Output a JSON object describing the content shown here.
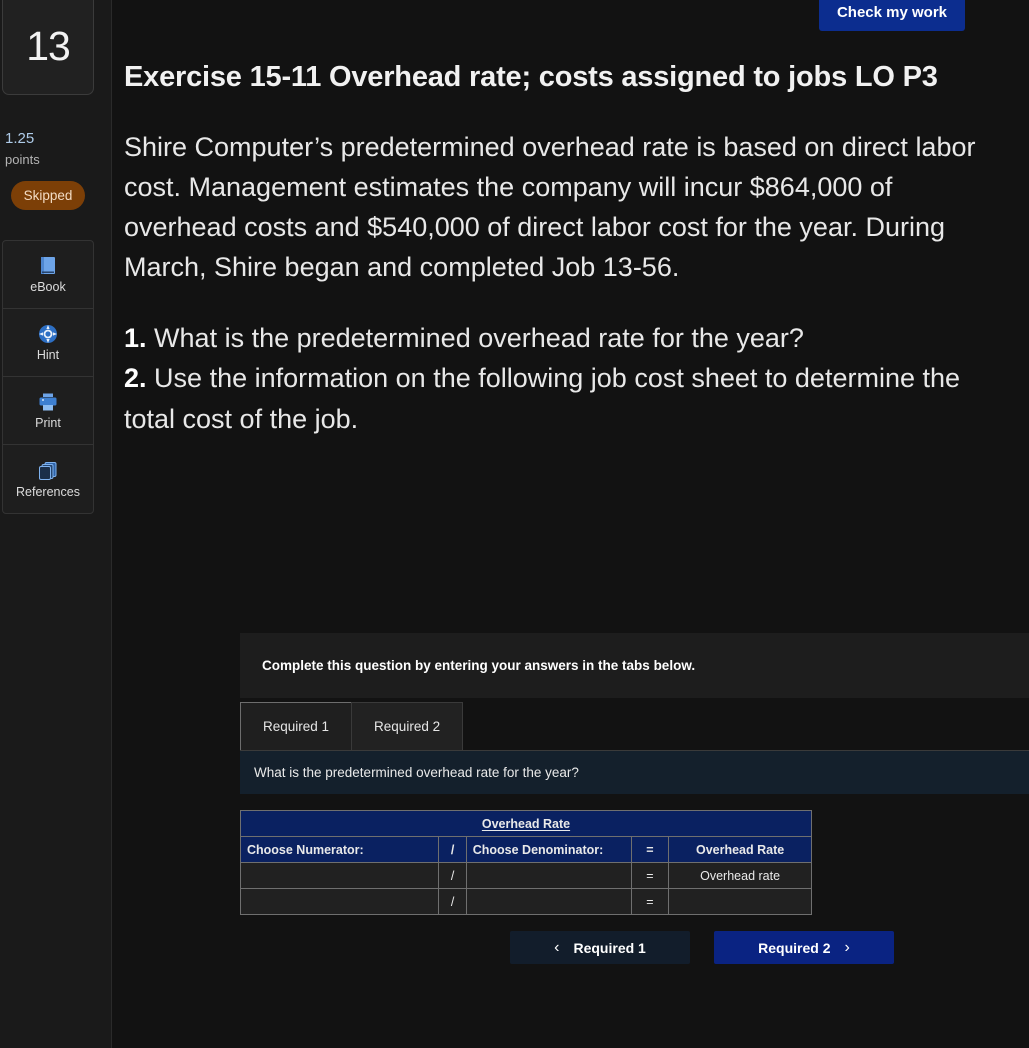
{
  "sidebar": {
    "question_number": "13",
    "points_value": "1.25",
    "points_label": "points",
    "status": "Skipped",
    "tools": [
      {
        "label": "eBook",
        "icon": "book-icon"
      },
      {
        "label": "Hint",
        "icon": "life-ring-icon"
      },
      {
        "label": "Print",
        "icon": "printer-icon"
      },
      {
        "label": "References",
        "icon": "copy-pages-icon"
      }
    ]
  },
  "toolbar": {
    "check_label": "Check my work"
  },
  "content": {
    "title": "Exercise 15-11 Overhead rate; costs assigned to jobs LO P3",
    "paragraph": "Shire Computer’s predetermined overhead rate is based on direct labor cost. Management estimates the company will incur $864,000 of overhead costs and $540,000 of direct labor cost for the year. During March, Shire began and completed Job 13-56.",
    "requirements": [
      {
        "number": "1.",
        "text": "What is the predetermined overhead rate for the year?"
      },
      {
        "number": "2.",
        "text": "Use the information on the following job cost sheet to determine the total cost of the job."
      }
    ]
  },
  "panel": {
    "instruction": "Complete this question by entering your answers in the tabs below.",
    "tabs": [
      {
        "label": "Required 1",
        "active": true
      },
      {
        "label": "Required 2",
        "active": false
      }
    ],
    "question": "What is the predetermined overhead rate for the year?"
  },
  "table": {
    "title": "Overhead Rate",
    "headers": {
      "numerator": "Choose Numerator:",
      "slash": "/",
      "denominator": "Choose Denominator:",
      "equals": "=",
      "rate": "Overhead Rate"
    },
    "rows": [
      {
        "numerator": "",
        "slash": "/",
        "denominator": "",
        "equals": "=",
        "rate": "Overhead rate"
      },
      {
        "numerator": "",
        "slash": "/",
        "denominator": "",
        "equals": "=",
        "rate": ""
      }
    ]
  },
  "footer": {
    "prev_label": "Required 1",
    "next_label": "Required 2",
    "prev_chevron": "‹",
    "next_chevron": "›"
  },
  "colors": {
    "header_blue": "#0a2161",
    "next_blue": "#0a2382",
    "check_blue": "#0c2d8f",
    "badge_orange": "#7c3f07",
    "points_blue": "#aecbe8",
    "question_bar": "#14202c"
  }
}
